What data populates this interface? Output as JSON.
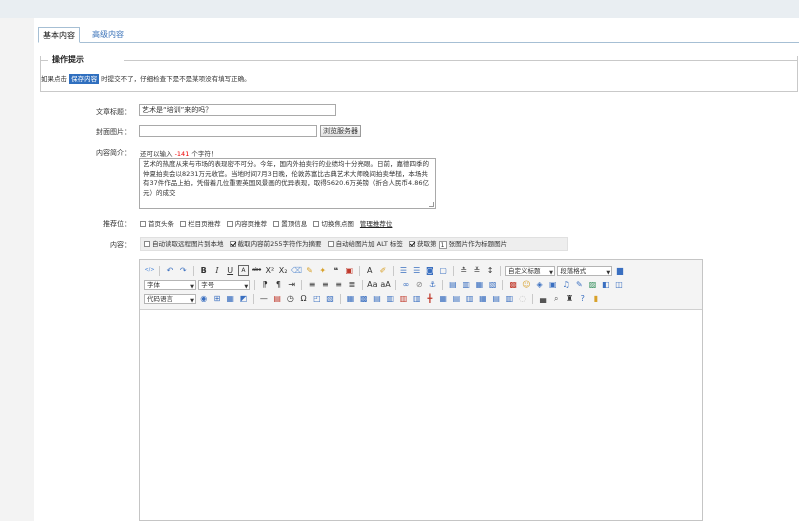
{
  "tabs": {
    "basic": "基本内容",
    "advanced": "高级内容"
  },
  "tips": {
    "legend": "操作提示",
    "before": "如果点击",
    "highlight": "保存内容",
    "after": "时提交不了，仔细检查下是不是某项没有填写正确。"
  },
  "form": {
    "title_label": "文章标题：",
    "title_value": "艺术是“培训”来的吗？",
    "cover_label": "封面图片：",
    "cover_value": "",
    "browse_button": "浏览服务器",
    "intro_label": "内容简介：",
    "counter_prefix": "还可以输入",
    "counter_value": "-141",
    "counter_suffix": "个字符！",
    "intro_text": "艺术的热度从来与市场的表现密不可分。今年，国内外拍卖行的业绩均十分亮眼。日前，嘉德四季的仲夏拍卖会以8231万元收官。当地时间7月3日晚，伦敦苏富比古典艺术大师晚间拍卖举槌，本场共有37件作品上拍，凭借着几位重要英国风景画的优异表现，取得5620.6万英镑（折合人民币4.86亿元）的成交",
    "recommend_label": "推荐位：",
    "recommend_options": [
      "首页头条",
      "栏目页推荐",
      "内容页推荐",
      "置顶信息",
      "切换焦点图"
    ],
    "manage_link": "管理推荐位",
    "content_label": "内容：",
    "content_opts": {
      "download_remote": "自动读取远程图片到本地",
      "extract_summary": "截取内容前255字符作为摘要",
      "alt_tag": "自动给图片加 ALT 标签",
      "get_nth_before": "获取第",
      "nth_value": "1",
      "get_nth_after": "张图片作为标题图片"
    }
  },
  "editor": {
    "font_family": "字体",
    "font_size": "字号",
    "custom_heading": "自定义标题",
    "paragraph_format": "段落格式",
    "code_language": "代码语言"
  }
}
